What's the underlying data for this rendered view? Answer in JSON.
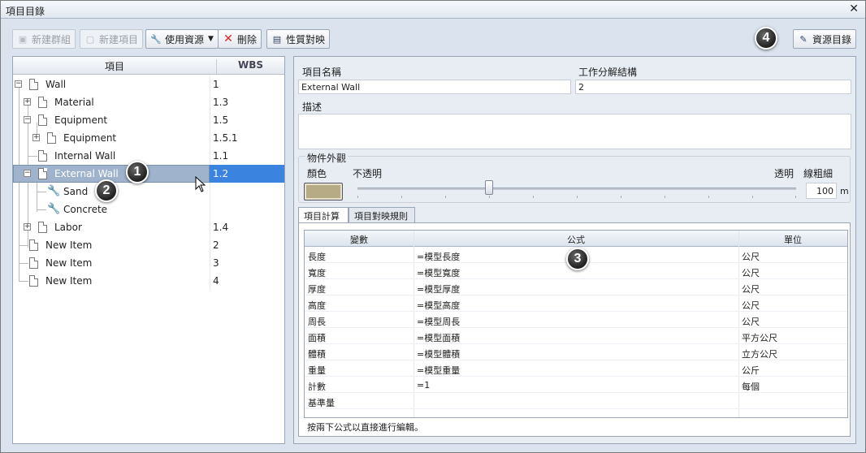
{
  "window": {
    "title": "項目目錄",
    "close_label": "✕"
  },
  "toolbar": {
    "new_group": "新建群組",
    "new_item": "新建項目",
    "use_resource": "使用資源",
    "delete": "刪除",
    "property_map": "性質對映",
    "resource_catalog": "資源目錄"
  },
  "tree": {
    "col_item": "項目",
    "col_wbs": "WBS",
    "rows": [
      {
        "label": "Wall",
        "wbs": "1"
      },
      {
        "label": "Material",
        "wbs": "1.3"
      },
      {
        "label": "Equipment",
        "wbs": "1.5"
      },
      {
        "label": "Equipment",
        "wbs": "1.5.1"
      },
      {
        "label": "Internal Wall",
        "wbs": "1.1"
      },
      {
        "label": "External Wall",
        "wbs": "1.2"
      },
      {
        "label": "Sand",
        "wbs": ""
      },
      {
        "label": "Concrete",
        "wbs": ""
      },
      {
        "label": "Labor",
        "wbs": "1.4"
      },
      {
        "label": "New Item",
        "wbs": "2"
      },
      {
        "label": "New Item",
        "wbs": "3"
      },
      {
        "label": "New Item",
        "wbs": "4"
      }
    ]
  },
  "detail": {
    "name_label": "項目名稱",
    "name_value": "External Wall",
    "wbs_label": "工作分解結構",
    "wbs_value": "2",
    "desc_label": "描述",
    "desc_value": "",
    "appearance_label": "物件外觀",
    "color_label": "顏色",
    "opaque_label": "不透明",
    "transparent_label": "透明",
    "line_width_label": "線粗細",
    "line_width_value": "100",
    "line_width_unit": "m",
    "opacity_level": 0.3,
    "swatch_color": "#b6ab85"
  },
  "tabs": {
    "calc": "項目計算",
    "mapping": "項目對映規則"
  },
  "grid": {
    "headers": {
      "var": "變數",
      "formula": "公式",
      "unit": "單位"
    },
    "rows": [
      {
        "var": "長度",
        "formula": "=模型長度",
        "unit": "公尺"
      },
      {
        "var": "寬度",
        "formula": "=模型寬度",
        "unit": "公尺"
      },
      {
        "var": "厚度",
        "formula": "=模型厚度",
        "unit": "公尺"
      },
      {
        "var": "高度",
        "formula": "=模型高度",
        "unit": "公尺"
      },
      {
        "var": "周長",
        "formula": "=模型周長",
        "unit": "公尺"
      },
      {
        "var": "面積",
        "formula": "=模型面積",
        "unit": "平方公尺"
      },
      {
        "var": "體積",
        "formula": "=模型體積",
        "unit": "立方公尺"
      },
      {
        "var": "重量",
        "formula": "=模型重量",
        "unit": "公斤"
      },
      {
        "var": "計數",
        "formula": "=1",
        "unit": "每個"
      },
      {
        "var": "基準量",
        "formula": "",
        "unit": ""
      }
    ],
    "hint": "按兩下公式以直接進行編輯。"
  },
  "badges": {
    "b1": "1",
    "b2": "2",
    "b3": "3",
    "b4": "4"
  },
  "colors": {
    "selection": "#3a84e0",
    "badge": "#202020"
  }
}
